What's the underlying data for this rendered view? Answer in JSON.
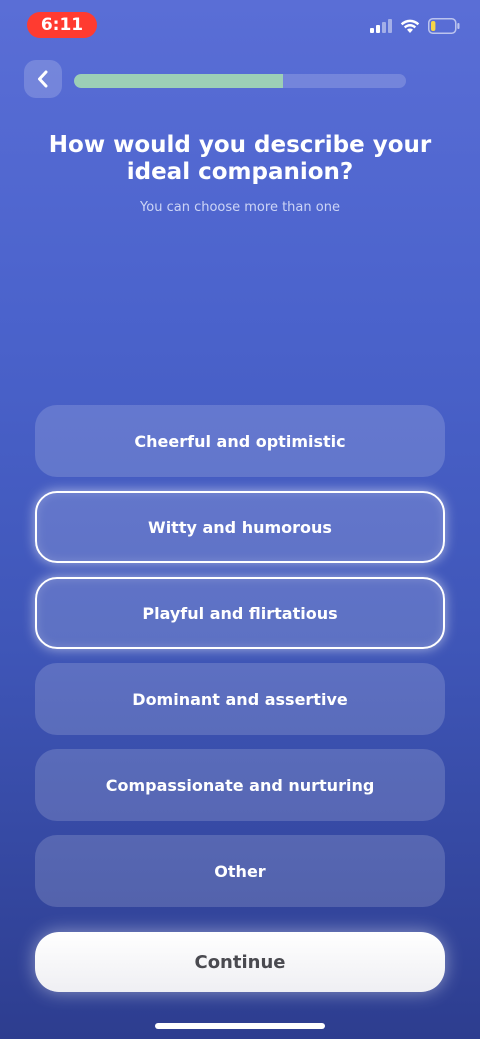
{
  "status_bar": {
    "time": "6:11",
    "battery_level": 0.2
  },
  "header": {
    "back_icon": "chevron-left-icon",
    "progress": 0.63
  },
  "question": {
    "title": "How would you describe your ideal companion?",
    "subtitle": "You can choose more than one"
  },
  "options": [
    {
      "label": "Cheerful and optimistic",
      "selected": false
    },
    {
      "label": "Witty and humorous",
      "selected": true
    },
    {
      "label": "Playful and flirtatious",
      "selected": true
    },
    {
      "label": "Dominant and assertive",
      "selected": false
    },
    {
      "label": "Compassionate and nurturing",
      "selected": false
    },
    {
      "label": "Other",
      "selected": false
    }
  ],
  "footer": {
    "continue_label": "Continue"
  },
  "colors": {
    "accent_progress": "#9ccfb6",
    "status_time_pill": "#ff3b30",
    "battery_fill": "#f5d547"
  }
}
